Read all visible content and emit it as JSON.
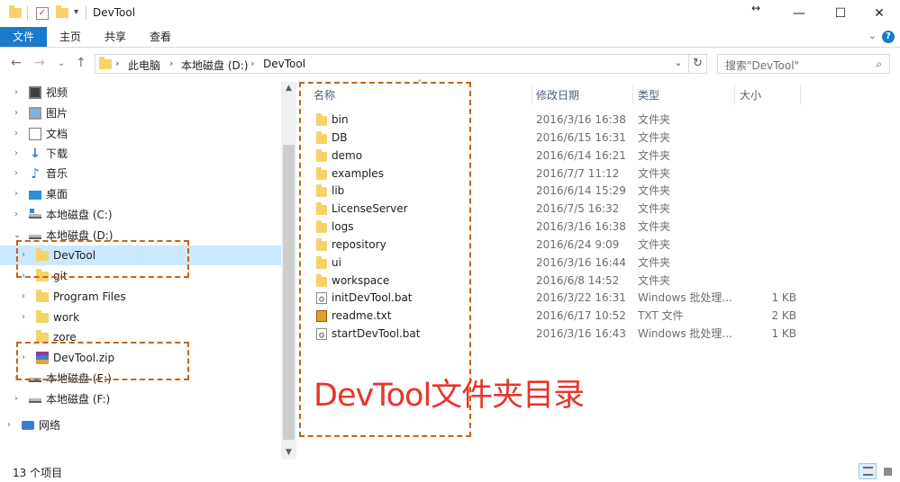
{
  "window": {
    "title": "DevTool",
    "controls": {
      "restore": "↔",
      "minimize": "—",
      "maximize": "☐",
      "close": "✕"
    }
  },
  "ribbon": {
    "tabs": [
      "文件",
      "主页",
      "共享",
      "查看"
    ],
    "help": "?"
  },
  "address": {
    "crumbs": [
      "此电脑",
      "本地磁盘 (D:)",
      "DevTool"
    ],
    "search_placeholder": "搜索\"DevTool\""
  },
  "navpane": {
    "items": [
      {
        "label": "视频",
        "icon": "video-icon"
      },
      {
        "label": "图片",
        "icon": "pictures-icon"
      },
      {
        "label": "文档",
        "icon": "documents-icon"
      },
      {
        "label": "下载",
        "icon": "download-icon"
      },
      {
        "label": "音乐",
        "icon": "music-icon"
      },
      {
        "label": "桌面",
        "icon": "desktop-icon"
      },
      {
        "label": "本地磁盘 (C:)",
        "icon": "drive-c-icon"
      },
      {
        "label": "本地磁盘 (D:)",
        "icon": "drive-icon"
      },
      {
        "label": "DevTool",
        "icon": "folder-icon"
      },
      {
        "label": "git",
        "icon": "folder-icon"
      },
      {
        "label": "Program Files",
        "icon": "folder-icon"
      },
      {
        "label": "work",
        "icon": "folder-icon"
      },
      {
        "label": "zore",
        "icon": "folder-icon"
      },
      {
        "label": "DevTool.zip",
        "icon": "zip-icon"
      },
      {
        "label": "本地磁盘 (E:)",
        "icon": "drive-icon"
      },
      {
        "label": "本地磁盘 (F:)",
        "icon": "drive-icon"
      },
      {
        "label": "网络",
        "icon": "network-icon"
      }
    ]
  },
  "list": {
    "columns": [
      "名称",
      "修改日期",
      "类型",
      "大小"
    ],
    "rows": [
      {
        "name": "bin",
        "date": "2016/3/16 16:38",
        "type": "文件夹",
        "size": "",
        "icon": "folder-icon"
      },
      {
        "name": "DB",
        "date": "2016/6/15 16:31",
        "type": "文件夹",
        "size": "",
        "icon": "folder-icon"
      },
      {
        "name": "demo",
        "date": "2016/6/14 16:21",
        "type": "文件夹",
        "size": "",
        "icon": "folder-icon"
      },
      {
        "name": "examples",
        "date": "2016/7/7 11:12",
        "type": "文件夹",
        "size": "",
        "icon": "folder-icon"
      },
      {
        "name": "lib",
        "date": "2016/6/14 15:29",
        "type": "文件夹",
        "size": "",
        "icon": "folder-icon"
      },
      {
        "name": "LicenseServer",
        "date": "2016/7/5 16:32",
        "type": "文件夹",
        "size": "",
        "icon": "folder-icon"
      },
      {
        "name": "logs",
        "date": "2016/3/16 16:38",
        "type": "文件夹",
        "size": "",
        "icon": "folder-icon"
      },
      {
        "name": "repository",
        "date": "2016/6/24 9:09",
        "type": "文件夹",
        "size": "",
        "icon": "folder-icon"
      },
      {
        "name": "ui",
        "date": "2016/3/16 16:44",
        "type": "文件夹",
        "size": "",
        "icon": "folder-icon"
      },
      {
        "name": "workspace",
        "date": "2016/6/8 14:52",
        "type": "文件夹",
        "size": "",
        "icon": "folder-icon"
      },
      {
        "name": "initDevTool.bat",
        "date": "2016/3/22 16:31",
        "type": "Windows 批处理...",
        "size": "1 KB",
        "icon": "batch-file-icon"
      },
      {
        "name": "readme.txt",
        "date": "2016/6/17 10:52",
        "type": "TXT 文件",
        "size": "2 KB",
        "icon": "text-file-icon"
      },
      {
        "name": "startDevTool.bat",
        "date": "2016/3/16 16:43",
        "type": "Windows 批处理...",
        "size": "1 KB",
        "icon": "batch-file-icon"
      }
    ]
  },
  "status": {
    "count": "13 个项目"
  },
  "annotation": {
    "caption": "DevTool文件夹目录",
    "color": "#e8352a",
    "box_color": "#c2651a"
  },
  "colors": {
    "accent": "#1979ca",
    "selection": "#cce8ff",
    "folder": "#f7d268"
  }
}
